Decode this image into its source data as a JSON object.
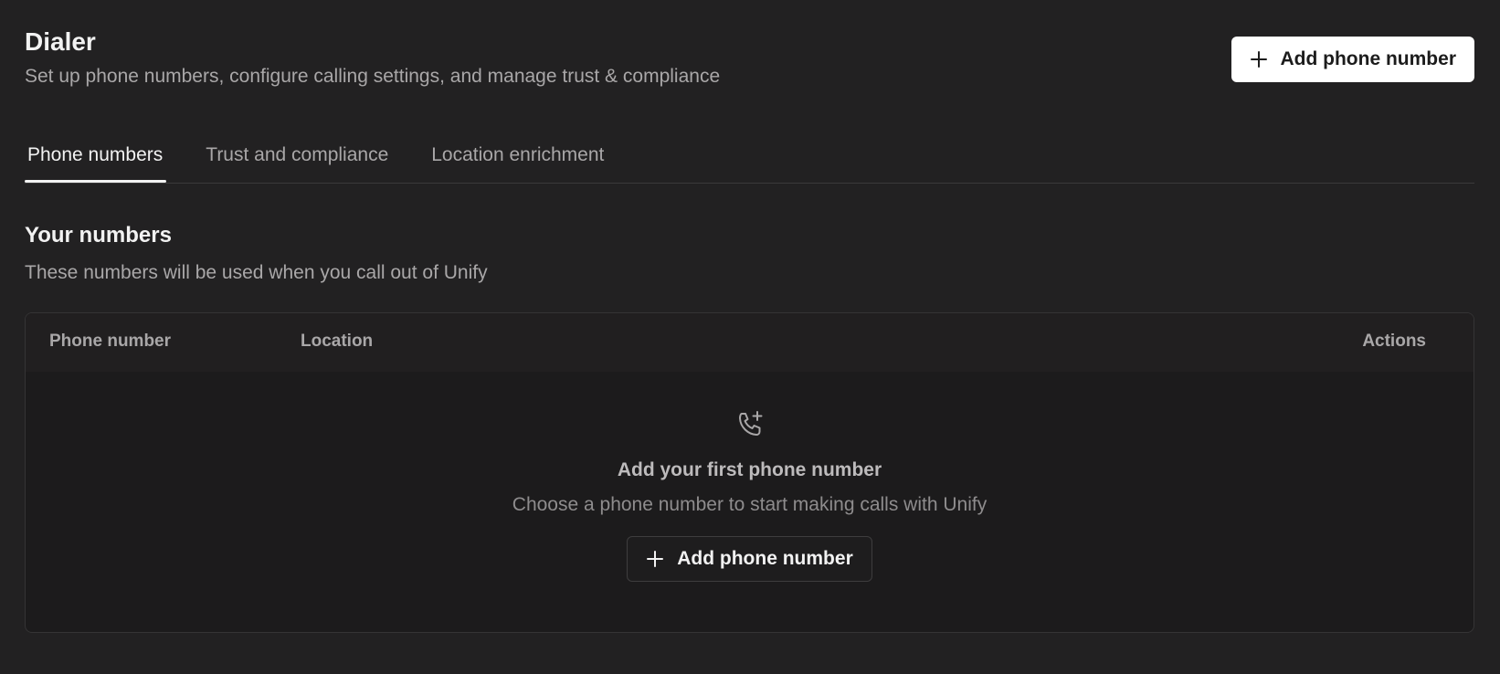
{
  "header": {
    "title": "Dialer",
    "subtitle": "Set up phone numbers, configure calling settings, and manage trust & compliance",
    "add_button_label": "Add phone number"
  },
  "tabs": [
    {
      "label": "Phone numbers",
      "active": true
    },
    {
      "label": "Trust and compliance",
      "active": false
    },
    {
      "label": "Location enrichment",
      "active": false
    }
  ],
  "section": {
    "title": "Your numbers",
    "description": "These numbers will be used when you call out of Unify"
  },
  "table": {
    "columns": [
      "Phone number",
      "Location",
      "Actions"
    ],
    "rows": []
  },
  "empty_state": {
    "icon": "phone-plus-icon",
    "title": "Add your first phone number",
    "description": "Choose a phone number to start making calls with Unify",
    "button_label": "Add phone number"
  },
  "colors": {
    "background": "#222122",
    "primary_button": "#ffffff",
    "muted_text": "#a9a7a8"
  }
}
